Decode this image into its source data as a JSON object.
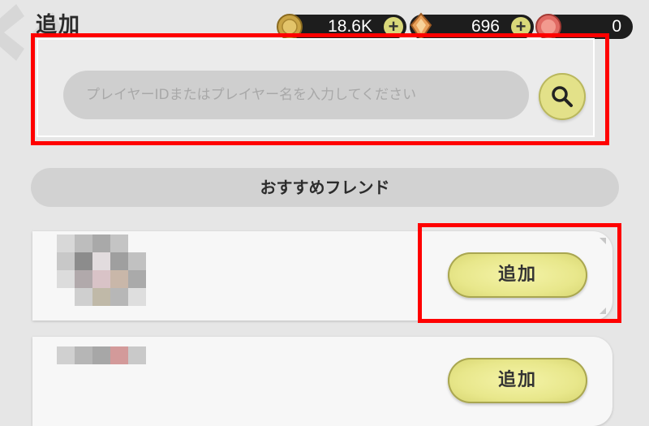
{
  "header": {
    "title": "追加",
    "dots": "....."
  },
  "currencies": [
    {
      "name": "gold-coins",
      "value": "18.6K",
      "icon": "gold-coin-icon",
      "has_plus": true
    },
    {
      "name": "crystal",
      "value": "696",
      "icon": "crystal-icon",
      "has_plus": true
    },
    {
      "name": "red-gem",
      "value": "0",
      "icon": "red-gem-icon",
      "has_plus": false
    }
  ],
  "plus_label": "+",
  "search": {
    "placeholder": "プレイヤーIDまたはプレイヤー名を入力してください",
    "value": "",
    "button_icon": "search-icon"
  },
  "recommended": {
    "header": "おすすめフレンド",
    "cards": [
      {
        "avatar": "pixelated-avatar",
        "button": "追加"
      },
      {
        "avatar": "pixelated-avatar",
        "button": "追加"
      }
    ]
  },
  "colors": {
    "highlight": "#ff0000",
    "button_yellow": "#e8e78b",
    "currency_bg": "#1d1d1d"
  }
}
